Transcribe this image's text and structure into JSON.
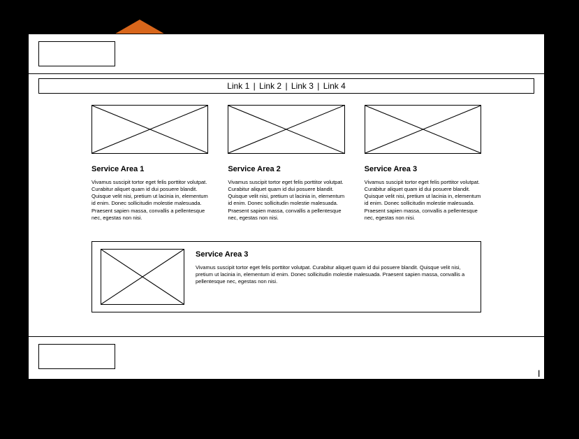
{
  "nav": {
    "links": [
      "Link 1",
      "Link 2",
      "Link 3",
      "Link 4"
    ]
  },
  "services": [
    {
      "title": "Service Area 1",
      "desc": "Vivamus suscipit tortor eget felis porttitor volutpat. Curabitur aliquet quam id dui posuere blandit. Quisque velit nisi, pretium ut lacinia in, elementum id enim. Donec sollicitudin molestie malesuada. Praesent sapien massa, convallis a pellentesque nec, egestas non nisi."
    },
    {
      "title": "Service Area 2",
      "desc": "Vivamus suscipit tortor eget felis porttitor volutpat. Curabitur aliquet quam id dui posuere blandit. Quisque velit nisi, pretium ut lacinia in, elementum id enim. Donec sollicitudin molestie malesuada. Praesent sapien massa, convallis a pellentesque nec, egestas non nisi."
    },
    {
      "title": "Service Area 3",
      "desc": "Vivamus suscipit tortor eget felis porttitor volutpat. Curabitur aliquet quam id dui posuere blandit. Quisque velit nisi, pretium ut lacinia in, elementum id enim. Donec sollicitudin molestie malesuada. Praesent sapien massa, convallis a pellentesque nec, egestas non nisi."
    }
  ],
  "feature": {
    "title": "Service Area 3",
    "desc": "Vivamus suscipit tortor eget felis porttitor volutpat. Curabitur aliquet quam id dui posuere blandit. Quisque velit nisi, pretium ut lacinia in, elementum id enim. Donec sollicitudin molestie malesuada. Praesent sapien massa, convallis a pellentesque nec, egestas non nisi."
  },
  "page_mark": "|"
}
